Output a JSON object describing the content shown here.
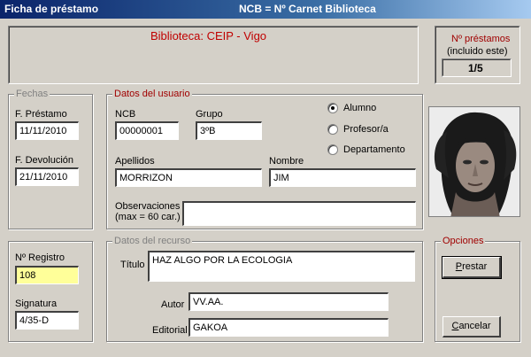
{
  "window": {
    "title_left": "Ficha de préstamo",
    "title_center": "NCB = Nº Carnet Biblioteca"
  },
  "header": {
    "library": "Biblioteca: CEIP - Vigo"
  },
  "loans_count": {
    "title_line1": "Nº préstamos",
    "title_line2": "(incluido este)",
    "value": "1/5"
  },
  "dates": {
    "legend": "Fechas",
    "loan_label": "F. Préstamo",
    "loan_value": "11/11/2010",
    "return_label": "F. Devolución",
    "return_value": "21/11/2010"
  },
  "user": {
    "legend": "Datos del usuario",
    "ncb_label": "NCB",
    "ncb_value": "00000001",
    "group_label": "Grupo",
    "group_value": "3ºB",
    "surname_label": "Apellidos",
    "surname_value": "MORRIZON",
    "name_label": "Nombre",
    "name_value": "JIM",
    "notes_label_1": "Observaciones",
    "notes_label_2": "(max = 60 car.)",
    "notes_value": "",
    "role_options": [
      "Alumno",
      "Profesor/a",
      "Departamento"
    ],
    "role_selected": "Alumno"
  },
  "registry": {
    "reg_label": "Nº Registro",
    "reg_value": "108",
    "sig_label": "Signatura",
    "sig_value": "4/35-D"
  },
  "resource": {
    "legend": "Datos del recurso",
    "title_label": "Título",
    "title_value": "HAZ ALGO POR LA ECOLOGIA",
    "author_label": "Autor",
    "author_value": "VV.AA.",
    "publisher_label": "Editorial",
    "publisher_value": "GAKOA"
  },
  "options": {
    "legend": "Opciones",
    "lend_label": "Prestar",
    "cancel_label": "Cancelar"
  },
  "colors": {
    "accent_red": "#a00000",
    "title_blue": "#0a246a",
    "highlight_yellow": "#ffff99"
  }
}
